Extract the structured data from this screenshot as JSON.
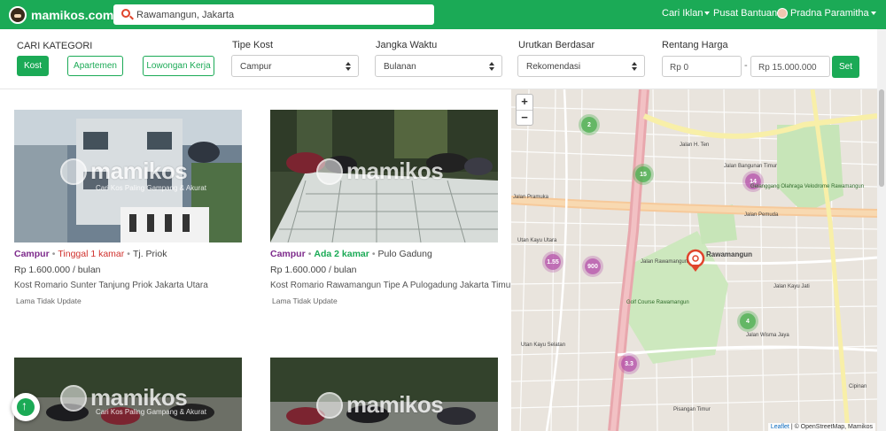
{
  "header": {
    "brand": "mamikos.com",
    "search": {
      "value": "Rawamangun, Jakarta",
      "icon": "search-pin-icon"
    },
    "nav": {
      "cari_iklan": "Cari Iklan",
      "pusat_bantuan": "Pusat Bantuan",
      "user_name": "Pradna Paramitha"
    },
    "colors": {
      "brand": "#1baa56"
    }
  },
  "filters": {
    "kategori_label": "CARI KATEGORI",
    "kategori": [
      "Kost",
      "Apartemen",
      "Lowongan Kerja"
    ],
    "tipe_kost": {
      "label": "Tipe Kost",
      "value": "Campur"
    },
    "jangka_waktu": {
      "label": "Jangka Waktu",
      "value": "Bulanan"
    },
    "urutkan": {
      "label": "Urutkan Berdasar",
      "value": "Rekomendasi"
    },
    "rentang_harga": {
      "label": "Rentang Harga",
      "min": "Rp 0",
      "max": "Rp 15.000.000",
      "set_label": "Set"
    }
  },
  "listings": [
    {
      "type": "Campur",
      "availability": "Tinggal 1 kamar",
      "location": "Tj. Priok",
      "price": "Rp 1.600.000 / bulan",
      "title": "Kost Romario Sunter Tanjung Priok Jakarta Utara",
      "update": "Lama Tidak Update"
    },
    {
      "type": "Campur",
      "availability": "Ada 2 kamar",
      "location": "Pulo Gadung",
      "price": "Rp 1.600.000 / bulan",
      "title": "Kost Romario Rawamangun Tipe A Pulogadung Jakarta Timur",
      "update": "Lama Tidak Update"
    },
    {
      "type": "",
      "availability": "",
      "location": "",
      "price": "",
      "title": "",
      "update": ""
    },
    {
      "type": "",
      "availability": "",
      "location": "",
      "price": "",
      "title": "",
      "update": ""
    }
  ],
  "watermark": {
    "brand": "mamikos",
    "tagline": "Cari Kos Paling Gampang & Akurat"
  },
  "map": {
    "zoom_in": "+",
    "zoom_out": "−",
    "clusters": [
      "2",
      "15",
      "14",
      "1.55",
      "900",
      "4",
      "3.3"
    ],
    "labels": [
      "Jalan Pramuka",
      "Jalan Pemuda",
      "Jalan Rawamangun",
      "Rawamangun",
      "Utan Kayu Utara",
      "Utan Kayu Selatan",
      "Golf Course Rawamangun",
      "Pisangan Timur",
      "Gelanggang Olahraga Velodrome Rawamangun",
      "Jalan Bangunan Timur",
      "Cipinan",
      "Jalan H. Ten",
      "Jalan Wisma Jaya",
      "Jalan Kayu Jati"
    ],
    "attribution_leaflet": "Leaflet",
    "attribution_rest": " | © OpenStreetMap, Mamikos"
  }
}
